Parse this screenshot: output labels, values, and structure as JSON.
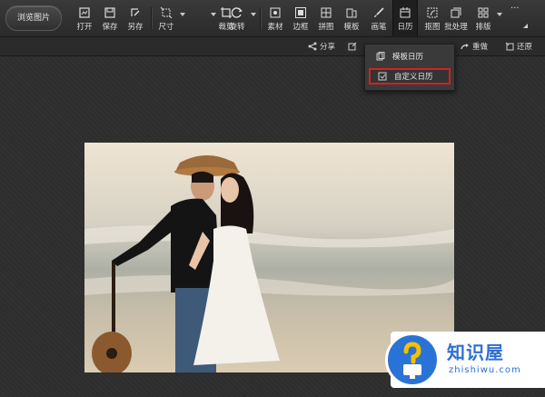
{
  "toolbar": {
    "browse_label": "浏览图片",
    "items": [
      {
        "label": "打开",
        "icon": "open-icon"
      },
      {
        "label": "保存",
        "icon": "save-icon"
      },
      {
        "label": "另存",
        "icon": "save-as-icon"
      },
      {
        "label": "尺寸",
        "icon": "resize-icon"
      },
      {
        "label": "裁剪",
        "icon": "crop-icon"
      },
      {
        "label": "旋转",
        "icon": "rotate-icon"
      },
      {
        "label": "素材",
        "icon": "material-icon"
      },
      {
        "label": "边框",
        "icon": "border-icon"
      },
      {
        "label": "拼图",
        "icon": "collage-icon"
      },
      {
        "label": "模板",
        "icon": "template-icon"
      },
      {
        "label": "画笔",
        "icon": "brush-icon"
      },
      {
        "label": "日历",
        "icon": "calendar-icon"
      },
      {
        "label": "抠图",
        "icon": "cutout-icon"
      },
      {
        "label": "批处理",
        "icon": "batch-icon"
      },
      {
        "label": "排版",
        "icon": "layout-icon"
      }
    ],
    "more_label": "···"
  },
  "subbar": {
    "share_label": "分享",
    "redo_label": "重做",
    "restore_label": "还原"
  },
  "calendar_menu": {
    "items": [
      {
        "label": "模板日历",
        "icon": "template-calendar-icon"
      },
      {
        "label": "自定义日历",
        "icon": "custom-calendar-icon"
      }
    ],
    "highlight_color": "#d42020"
  },
  "watermark": {
    "title": "知识屋",
    "url": "zhishiwu.com",
    "color": "#2a73d6"
  }
}
